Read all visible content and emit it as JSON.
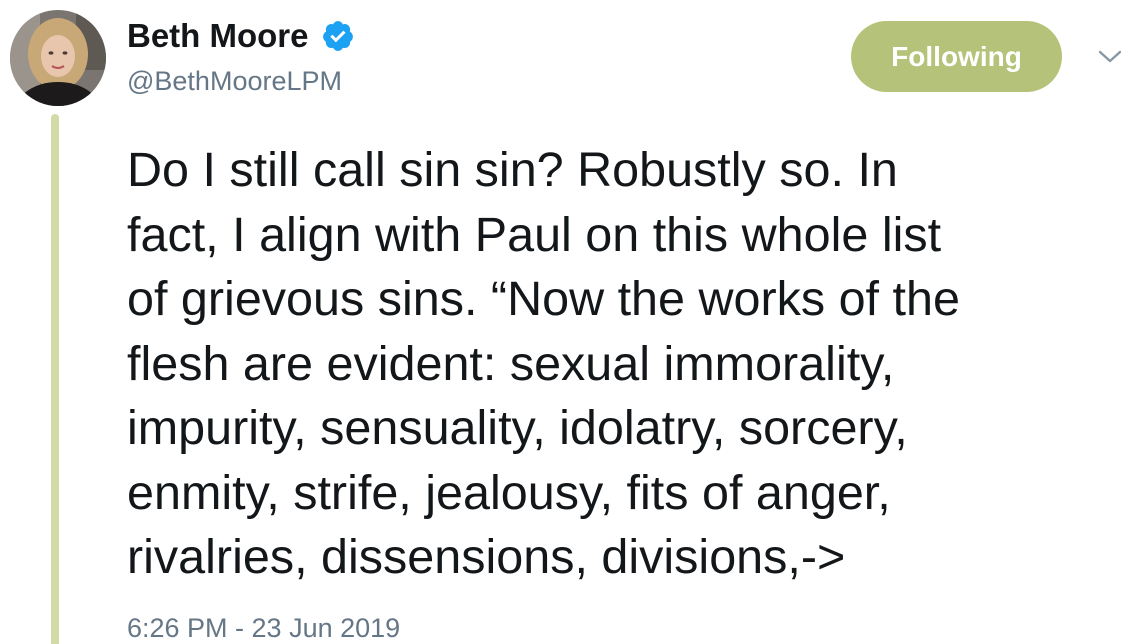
{
  "author": {
    "display_name": "Beth Moore",
    "handle": "@BethMooreLPM",
    "verified": true
  },
  "follow_button": {
    "label": "Following"
  },
  "tweet": {
    "lines": [
      "Do I still call sin sin? Robustly so. In",
      "fact, I align with Paul on this whole list",
      "of grievous sins. “Now the works of the",
      "flesh are evident: sexual immorality,",
      "impurity, sensuality, idolatry, sorcery,",
      "enmity, strife, jealousy, fits of anger,",
      "rivalries, dissensions, divisions,->"
    ],
    "timestamp": "6:26 PM - 23 Jun 2019"
  },
  "icons": {
    "verified": "verified-badge-icon",
    "menu": "chevron-down-icon"
  },
  "colors": {
    "follow_button_bg": "#b5c37a",
    "thread_line": "#d2dba7",
    "verified_badge": "#1da1f2",
    "secondary_text": "#657786",
    "primary_text": "#14171a"
  }
}
